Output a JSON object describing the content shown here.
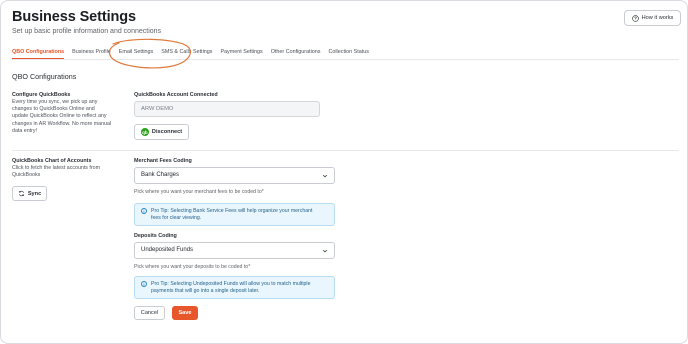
{
  "header": {
    "title": "Business Settings",
    "subtitle": "Set up basic profile information and connections",
    "how_it_works": "How it works"
  },
  "tabs": [
    {
      "label": "QBO Configurations",
      "active": true
    },
    {
      "label": "Business Profile",
      "active": false
    },
    {
      "label": "Email Settings",
      "active": false
    },
    {
      "label": "SMS & Calls Settings",
      "active": false
    },
    {
      "label": "Payment Settings",
      "active": false
    },
    {
      "label": "Other Configurations",
      "active": false
    },
    {
      "label": "Collection Status",
      "active": false
    }
  ],
  "section_title": "QBO Configurations",
  "configure": {
    "heading": "Configure QuickBooks",
    "description": [
      "Every time you sync, we pick up any",
      "changes to QuickBooks Online and",
      "update QuickBooks Online to reflect any",
      "changes in AR Workflow. No more manual",
      "data entry!"
    ],
    "account_label": "QuickBooks Account Connected",
    "account_value": "ARW DEMO",
    "disconnect_label": "Disconnect",
    "qb_icon": "qb"
  },
  "chart_of_accounts": {
    "heading": "QuickBooks Chart of Accounts",
    "description": [
      "Click to fetch the latest accounts from",
      "QuickBooks"
    ],
    "sync_label": "Sync"
  },
  "merchant_fees": {
    "label": "Merchant Fees Coding",
    "value": "Bank Charges",
    "helper": "Pick where you want your merchant fees to be coded to*",
    "tip": [
      "Pro Tip: Selecting Bank Service Fees will help organize your merchant",
      "fees for clear viewing."
    ]
  },
  "deposits": {
    "label": "Deposits Coding",
    "value": "Undeposited Funds",
    "helper": "Pick where you want your deposits to be coded to*",
    "tip": [
      "Pro Tip: Selecting Undeposited Funds will allow you to match multiple",
      "payments that will go into a single deposit later."
    ]
  },
  "actions": {
    "cancel_label": "Cancel",
    "save_label": "Save"
  },
  "colors": {
    "accent": "#e8562b",
    "tip_bg": "#eaf6fd",
    "qb_green": "#2ca01c"
  }
}
